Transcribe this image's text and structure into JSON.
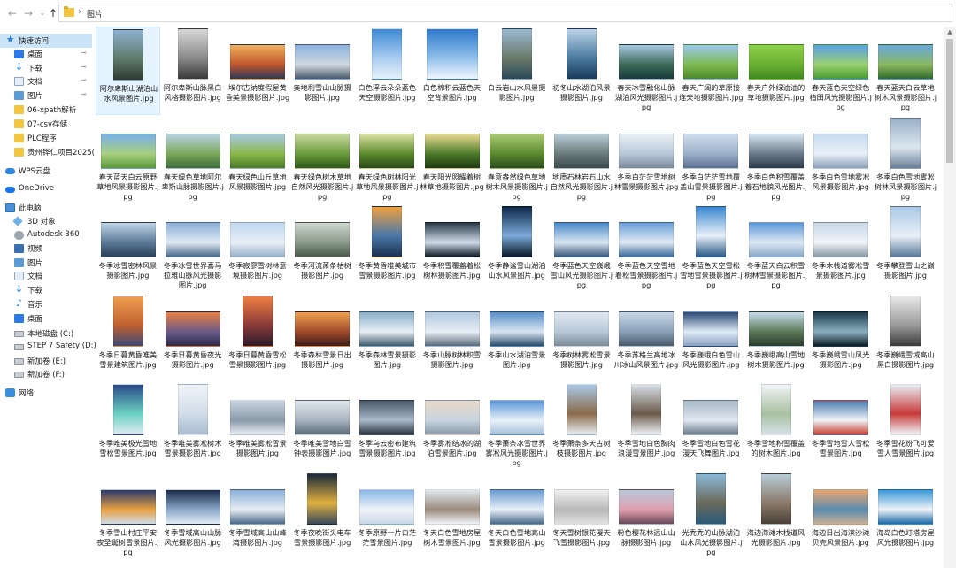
{
  "address": {
    "current_folder": "图片"
  },
  "sidebar": {
    "items": [
      {
        "label": "快速访问",
        "icon": "star-icon",
        "selected": true,
        "pinned": false
      },
      {
        "label": "桌面",
        "icon": "desktop-icon",
        "pinned": true
      },
      {
        "label": "下载",
        "icon": "download-icon",
        "pinned": true
      },
      {
        "label": "文档",
        "icon": "document-icon",
        "pinned": true
      },
      {
        "label": "图片",
        "icon": "pictures-icon",
        "pinned": true
      },
      {
        "label": "06-xpath解析",
        "icon": "folder-icon"
      },
      {
        "label": "07-csv存储",
        "icon": "folder-icon"
      },
      {
        "label": "PLC程序",
        "icon": "folder-icon"
      },
      {
        "label": "贵州铧仁项目2025(",
        "icon": "folder-icon"
      },
      {
        "label": "WPS云盘",
        "icon": "cloud-icon"
      },
      {
        "label": "OneDrive",
        "icon": "onedrive-icon"
      },
      {
        "label": "此电脑",
        "icon": "computer-icon"
      },
      {
        "label": "3D 对象",
        "icon": "3d-objects-icon"
      },
      {
        "label": "Autodesk 360",
        "icon": "autodesk-icon"
      },
      {
        "label": "视频",
        "icon": "video-icon"
      },
      {
        "label": "图片",
        "icon": "pictures-icon"
      },
      {
        "label": "文档",
        "icon": "document-icon"
      },
      {
        "label": "下载",
        "icon": "download-icon"
      },
      {
        "label": "音乐",
        "icon": "music-icon"
      },
      {
        "label": "桌面",
        "icon": "desktop-icon"
      },
      {
        "label": "本地磁盘 (C:)",
        "icon": "drive-icon"
      },
      {
        "label": "STEP 7 Safety (D:)",
        "icon": "drive-icon"
      },
      {
        "label": "新加卷 (E:)",
        "icon": "drive-icon"
      },
      {
        "label": "新加卷 (F:)",
        "icon": "drive-icon"
      },
      {
        "label": "网络",
        "icon": "network-icon"
      }
    ]
  },
  "files": [
    {
      "name": "阿尔卑斯山湖泊山水风景图片.jpg",
      "colors": [
        "#8fb0d0",
        "#5f7a6a",
        "#2e3a32"
      ],
      "shape": "portrait"
    },
    {
      "name": "阿尔卑斯山脉黑白风格摄影图片.jpg",
      "colors": [
        "#d8d8d8",
        "#8a8a8a",
        "#3a3a3a"
      ],
      "shape": "portrait"
    },
    {
      "name": "埃尔古纳度假屋黄昏美景摄影图片.jpg",
      "colors": [
        "#f0b05a",
        "#c0562e",
        "#2a3a58"
      ],
      "shape": "landscape"
    },
    {
      "name": "奥地利雪山山脉摄影图片.jpg",
      "colors": [
        "#8ab4e0",
        "#d0d8e0",
        "#4a5a6a"
      ],
      "shape": "landscape"
    },
    {
      "name": "白色浮云朵朵蓝色天空摄影图片.jpg",
      "colors": [
        "#3f8ad8",
        "#a8cdf0",
        "#e8f2fa"
      ],
      "shape": "portrait"
    },
    {
      "name": "白色棉积云蓝色天空背景图片.jpg",
      "colors": [
        "#2f78cc",
        "#8fc0ea",
        "#f0f6fc"
      ],
      "shape": "square"
    },
    {
      "name": "白云岩山水风景摄影图片.jpg",
      "colors": [
        "#9ab8d0",
        "#6a7a6a",
        "#2a4a5a"
      ],
      "shape": "portrait"
    },
    {
      "name": "初冬山水湖泊风景摄影图片.jpg",
      "colors": [
        "#bcd4e8",
        "#4a7aa0",
        "#1a3a5a"
      ],
      "shape": "portrait"
    },
    {
      "name": "春天冰雪融化山脉湖泊风光摄影图片.jpg",
      "colors": [
        "#a8c8e0",
        "#3a6a58",
        "#1a3a3a"
      ],
      "shape": "landscape"
    },
    {
      "name": "春天广阔的草原接连天地摄影图片.jpg",
      "colors": [
        "#9ac8f0",
        "#7fba50",
        "#4a8a2a"
      ],
      "shape": "landscape"
    },
    {
      "name": "春天户外绿油油的草地摄影图片.jpg",
      "colors": [
        "#8fcf4a",
        "#6ab030",
        "#3f8a20"
      ],
      "shape": "landscape"
    },
    {
      "name": "春天蓝色天空绿色植田风光摄影图片.jpg",
      "colors": [
        "#5aa0e8",
        "#9ad070",
        "#4a9a30"
      ],
      "shape": "landscape"
    },
    {
      "name": "春天蓝天白云草地树木风景摄影图片.jpg",
      "colors": [
        "#6aa8e0",
        "#8ab860",
        "#2f6a2a"
      ],
      "shape": "landscape"
    },
    {
      "name": "春天蓝天白云原野草地风景摄影图片.jpg",
      "colors": [
        "#7ab0e8",
        "#a8d080",
        "#5a9a3a"
      ],
      "shape": "landscape"
    },
    {
      "name": "春天绿色草地阿尔卑斯山脉摄影图片.jpg",
      "colors": [
        "#b8d0e0",
        "#7aa85a",
        "#3a6a3a"
      ],
      "shape": "landscape"
    },
    {
      "name": "春天绿色山丘草地风景摄影图片.jpg",
      "colors": [
        "#a8c8e0",
        "#8ab84a",
        "#4a7a2a"
      ],
      "shape": "landscape"
    },
    {
      "name": "春天绿色树木草地自然风光摄影图片.jpg",
      "colors": [
        "#c8d8a0",
        "#6a9a3a",
        "#2f5a1a"
      ],
      "shape": "landscape"
    },
    {
      "name": "春天绿色树林阳光草地风景摄影图片.jpg",
      "colors": [
        "#d8e0a0",
        "#5a8a2a",
        "#2a4a1a"
      ],
      "shape": "landscape"
    },
    {
      "name": "春天阳光照耀着树林草地摄影图片.jpg",
      "colors": [
        "#e8d890",
        "#4a7a2a",
        "#1f3a12"
      ],
      "shape": "landscape"
    },
    {
      "name": "春意盎然绿色草地树木风景摄影图片.jpg",
      "colors": [
        "#a8c870",
        "#5a8a30",
        "#2a4a1a"
      ],
      "shape": "landscape"
    },
    {
      "name": "地质石林岩石山水自然风光摄影图片.jpg",
      "colors": [
        "#b8ccd8",
        "#6a7a7a",
        "#3a4a4a"
      ],
      "shape": "landscape"
    },
    {
      "name": "冬季白茫茫雪地树林雪景摄影图片.jpg",
      "colors": [
        "#e8eef4",
        "#b8c8d8",
        "#7a8a9a"
      ],
      "shape": "landscape"
    },
    {
      "name": "冬季白茫茫雪地覆盖山雪景摄影图片.jpg",
      "colors": [
        "#d0dcec",
        "#9ab0c8",
        "#5a7090"
      ],
      "shape": "landscape"
    },
    {
      "name": "冬季白色积雪覆盖着石地貌风光图片.jpg",
      "colors": [
        "#d8e4f0",
        "#6a7a8a",
        "#2a3a4a"
      ],
      "shape": "landscape"
    },
    {
      "name": "冬季白色雪地雾凇风景摄影图片.jpg",
      "colors": [
        "#c8dcf0",
        "#e8f0f8",
        "#8aa0b8"
      ],
      "shape": "landscape"
    },
    {
      "name": "冬季白色雪地雾凇树林风景摄影图片.jpg",
      "colors": [
        "#9ab0c8",
        "#dce6f0",
        "#6a8098"
      ],
      "shape": "portrait"
    },
    {
      "name": "冬季冰雪密林风景摄影图片.jpg",
      "colors": [
        "#c0d4e6",
        "#5a7a98",
        "#2a4058"
      ],
      "shape": "landscape"
    },
    {
      "name": "冬季冰雪世界喜马拉雅山脉风光摄影图片.jpg",
      "colors": [
        "#8ab0d8",
        "#e0eaf4",
        "#4a6a8a"
      ],
      "shape": "landscape"
    },
    {
      "name": "冬季寂寥雪树林意境摄影图片.jpg",
      "colors": [
        "#c0d8f0",
        "#e8f0f8",
        "#9ab0c8"
      ],
      "shape": "landscape"
    },
    {
      "name": "冬季河流萧条枯树摄影图片.jpg",
      "colors": [
        "#d0d8d0",
        "#8a9a8a",
        "#4a5a4a"
      ],
      "shape": "landscape"
    },
    {
      "name": "冬季黄昏唯美城市雪景摄影图片.jpg",
      "colors": [
        "#f0a040",
        "#4a78a8",
        "#1a3050"
      ],
      "shape": "portrait"
    },
    {
      "name": "冬季积雪覆盖着松树林摄影图片.jpg",
      "colors": [
        "#2a3a4a",
        "#d0dce8",
        "#0e1a26"
      ],
      "shape": "landscape"
    },
    {
      "name": "冬季静谧雪山湖泊山水风景图片.jpg",
      "colors": [
        "#0e2a4a",
        "#7aa8d8",
        "#081828"
      ],
      "shape": "portrait"
    },
    {
      "name": "冬季蓝色天空巍峨雪山风光摄影图片.jpg",
      "colors": [
        "#4a88c8",
        "#d8e6f2",
        "#3a5a7a"
      ],
      "shape": "landscape"
    },
    {
      "name": "冬季蓝色天空雪地着松雪景摄影图片.jpg",
      "colors": [
        "#6aa0d8",
        "#e0eaf4",
        "#3a6a98"
      ],
      "shape": "landscape"
    },
    {
      "name": "冬季蓝色天空雪松雪地雪景摄影图片.jpg",
      "colors": [
        "#3a88d0",
        "#e8f0f8",
        "#2a5a88"
      ],
      "shape": "portrait"
    },
    {
      "name": "冬季蓝天白云积雪树林雪景摄影图片.jpg",
      "colors": [
        "#5a98d8",
        "#dce8f4",
        "#8aa8c8"
      ],
      "shape": "landscape"
    },
    {
      "name": "冬季木栈道雾凇雪景摄影图片.jpg",
      "colors": [
        "#c8d8e8",
        "#f0f4f8",
        "#8a9aa8"
      ],
      "shape": "landscape"
    },
    {
      "name": "冬季攀登雪山之巅摄影图片.jpg",
      "colors": [
        "#a8c8e4",
        "#e8f0f8",
        "#5a7a98"
      ],
      "shape": "portrait"
    },
    {
      "name": "冬季日暮黄昏唯美雪景建筑图片.jpg",
      "colors": [
        "#f0a050",
        "#c06030",
        "#3a4a78"
      ],
      "shape": "portrait"
    },
    {
      "name": "冬季日暮黄昏夜光摄影图片.jpg",
      "colors": [
        "#e88040",
        "#6a5a8a",
        "#2a2a4a"
      ],
      "shape": "landscape"
    },
    {
      "name": "冬季日暮黄昏雪松雪景摄影图片.jpg",
      "colors": [
        "#f08040",
        "#8a3a3a",
        "#2a1a2a"
      ],
      "shape": "portrait"
    },
    {
      "name": "冬季森林雪景日出摄影图片.jpg",
      "colors": [
        "#f0a050",
        "#a04a2a",
        "#3a1a1a"
      ],
      "shape": "landscape"
    },
    {
      "name": "冬季森林雪景摄影图片.jpg",
      "colors": [
        "#8ab0c8",
        "#e8eef4",
        "#3a5a6a"
      ],
      "shape": "landscape"
    },
    {
      "name": "冬季山脉树林积雪摄影图片.jpg",
      "colors": [
        "#b0c8e0",
        "#e8eef4",
        "#5a6a7a"
      ],
      "shape": "landscape"
    },
    {
      "name": "冬季山水湖泊雪景图片.jpg",
      "colors": [
        "#5a90c8",
        "#d8e4f0",
        "#2a4a6a"
      ],
      "shape": "landscape"
    },
    {
      "name": "冬季树林雾凇雪景摄影图片.jpg",
      "colors": [
        "#e0e8f0",
        "#b8c8d8",
        "#7a8a98"
      ],
      "shape": "landscape"
    },
    {
      "name": "冬季苏格兰高地冰川冰山风景图片.jpg",
      "colors": [
        "#c8d8e8",
        "#8aa0b8",
        "#4a5a6a"
      ],
      "shape": "landscape"
    },
    {
      "name": "冬季巍峨白色雪山风光摄影图片.jpg",
      "colors": [
        "#2a4a78",
        "#e0eaf4",
        "#8aa0c0"
      ],
      "shape": "landscape"
    },
    {
      "name": "冬季巍峨高山雪地树木摄影图片.jpg",
      "colors": [
        "#c8dcec",
        "#5a7a58",
        "#2a3a2a"
      ],
      "shape": "landscape"
    },
    {
      "name": "冬季巍峨雪山风光摄影图片.jpg",
      "colors": [
        "#1a3a4a",
        "#8ab0c0",
        "#0a1a22"
      ],
      "shape": "landscape"
    },
    {
      "name": "冬季巍峨雪域高山黑白摄影图片.jpg",
      "colors": [
        "#e8e8e8",
        "#9a9a9a",
        "#3a3a3a"
      ],
      "shape": "portrait"
    },
    {
      "name": "冬季唯美极光雪地雪松雪景图片.jpg",
      "colors": [
        "#2a4a8a",
        "#6ad0c0",
        "#e0eaf4"
      ],
      "shape": "portrait"
    },
    {
      "name": "冬季唯美雾凇树木雪景摄影图片.jpg",
      "colors": [
        "#f0f4f8",
        "#d0dce8",
        "#aabcd0"
      ],
      "shape": "portrait"
    },
    {
      "name": "冬季唯美雾凇雪景摄影图片.jpg",
      "colors": [
        "#c8d4e0",
        "#8a9aa8",
        "#e8eef4"
      ],
      "shape": "landscape"
    },
    {
      "name": "冬季唯美雪地白雪钟表摄影图片.jpg",
      "colors": [
        "#e0e6ec",
        "#a8b4c0",
        "#5a6a78"
      ],
      "shape": "landscape"
    },
    {
      "name": "冬季乌云密布建筑雪景摄影图片.jpg",
      "colors": [
        "#4a5a6a",
        "#a8b8c8",
        "#2a3440"
      ],
      "shape": "landscape"
    },
    {
      "name": "冬季雾凇结冰的湖泊雪景图片.jpg",
      "colors": [
        "#e8d8c8",
        "#c8d4e0",
        "#8a9aa8"
      ],
      "shape": "landscape"
    },
    {
      "name": "冬季萧条冰雪世界雾凇风光摄影图片.jpg",
      "colors": [
        "#5a98d8",
        "#e8f0f8",
        "#a8c0d8"
      ],
      "shape": "landscape"
    },
    {
      "name": "冬季萧条多天古树枝摄影图片.jpg",
      "colors": [
        "#a8c8e8",
        "#8a6a4a",
        "#e8eef4"
      ],
      "shape": "portrait"
    },
    {
      "name": "冬季雪地白色胸肉浪漫雪景图片.jpg",
      "colors": [
        "#d8e0e8",
        "#6a5a4a",
        "#f0f4f8"
      ],
      "shape": "portrait"
    },
    {
      "name": "冬季雪地白色雪花漫天飞舞图片.jpg",
      "colors": [
        "#a8b8c8",
        "#e0e8f0",
        "#6a7a88"
      ],
      "shape": "landscape"
    },
    {
      "name": "冬季雪地积雪覆盖的树木图片.jpg",
      "colors": [
        "#f0f4f8",
        "#a8c0a0",
        "#d8e0e8"
      ],
      "shape": "portrait"
    },
    {
      "name": "冬季雪地雪人雪松雪景图片.jpg",
      "colors": [
        "#4a7ab0",
        "#f0f4f8",
        "#c84030"
      ],
      "shape": "landscape"
    },
    {
      "name": "冬季雪花纷飞可爱雪人雪景图片.jpg",
      "colors": [
        "#e8eef4",
        "#c83a3a",
        "#f0f4f8"
      ],
      "shape": "portrait"
    },
    {
      "name": "冬季雪山村庄平安夜圣诞树雪景图片.jpg",
      "colors": [
        "#2a3a6a",
        "#e8a040",
        "#d0dce8"
      ],
      "shape": "landscape"
    },
    {
      "name": "冬季雪域高山山脉风光摄影图片.jpg",
      "colors": [
        "#1a2a4a",
        "#8aa8c8",
        "#e0eaf4"
      ],
      "shape": "landscape"
    },
    {
      "name": "冬季雪域高山山峰湾摄影图片.jpg",
      "colors": [
        "#8ab0d8",
        "#e8eef4",
        "#4a6a8a"
      ],
      "shape": "landscape"
    },
    {
      "name": "冬季夜晚街头电车雪景摄影图片.jpg",
      "colors": [
        "#1a2a3a",
        "#e0b040",
        "#3a4a5a"
      ],
      "shape": "portrait"
    },
    {
      "name": "冬季原野一片白茫茫雪景图片.jpg",
      "colors": [
        "#8ab8e8",
        "#f0f4f8",
        "#c8d8e8"
      ],
      "shape": "landscape"
    },
    {
      "name": "冬天白色雪地房屋树木雪景图片.jpg",
      "colors": [
        "#e0e8f0",
        "#9a8a7a",
        "#f0f4f8"
      ],
      "shape": "landscape"
    },
    {
      "name": "冬天白色雪地高山雪景摄影图片.jpg",
      "colors": [
        "#6a9ad0",
        "#e8f0f8",
        "#4a6a88"
      ],
      "shape": "landscape"
    },
    {
      "name": "冬天雪树银花漫天飞雪摄影图片.jpg",
      "colors": [
        "#f0f0f0",
        "#b8b8b8",
        "#e0e0e0"
      ],
      "shape": "landscape"
    },
    {
      "name": "粉色樱花林远山山脉摄影图片.jpg",
      "colors": [
        "#b8c8d8",
        "#e0a0b0",
        "#6a4a5a"
      ],
      "shape": "landscape"
    },
    {
      "name": "光秃秃的山脉湖泊山水风光摄影图片.jpg",
      "colors": [
        "#8ab8d8",
        "#6a6a5a",
        "#2a5a7a"
      ],
      "shape": "portrait"
    },
    {
      "name": "海边海滩木栈道风光摄影图片.jpg",
      "colors": [
        "#b8ccd8",
        "#8a7a6a",
        "#4a4038"
      ],
      "shape": "portrait"
    },
    {
      "name": "海边日出海滨沙滩贝壳风景图片.jpg",
      "colors": [
        "#e8a870",
        "#5a8ab0",
        "#c8b098"
      ],
      "shape": "landscape"
    },
    {
      "name": "海岛白色灯塔房屋风光摄影图片.jpg",
      "colors": [
        "#3a98d8",
        "#f0f4f8",
        "#1a6aa8"
      ],
      "shape": "landscape"
    }
  ]
}
